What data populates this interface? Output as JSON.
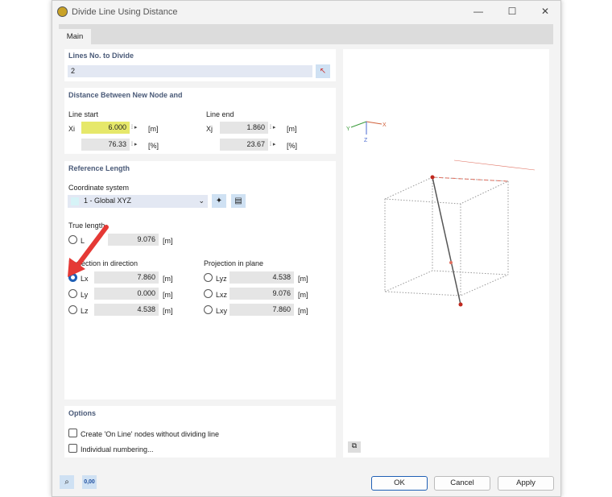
{
  "window": {
    "title": "Divide Line Using Distance",
    "minimize": "—",
    "maximize": "☐",
    "close": "✕"
  },
  "tabs": [
    {
      "label": "Main"
    }
  ],
  "lines": {
    "heading": "Lines No. to Divide",
    "value": "2"
  },
  "distance": {
    "heading": "Distance Between New Node and",
    "start": {
      "label": "Line start",
      "sym": "Xi",
      "value": "6.000",
      "unit": "[m]",
      "pct": "76.33",
      "pct_unit": "[%]"
    },
    "end": {
      "label": "Line end",
      "sym": "Xj",
      "value": "1.860",
      "unit": "[m]",
      "pct": "23.67",
      "pct_unit": "[%]"
    }
  },
  "reference": {
    "heading": "Reference Length",
    "cs_label": "Coordinate system",
    "cs_value": "1 - Global XYZ",
    "true_label": "True length",
    "true": {
      "sym": "L",
      "value": "9.076",
      "unit": "[m]"
    },
    "dir_label": "Projection in direction",
    "plane_label": "Projection in plane",
    "dir": [
      {
        "sym": "Lx",
        "value": "7.860",
        "unit": "[m]",
        "selected": true
      },
      {
        "sym": "Ly",
        "value": "0.000",
        "unit": "[m]"
      },
      {
        "sym": "Lz",
        "value": "4.538",
        "unit": "[m]"
      }
    ],
    "plane": [
      {
        "sym": "Lyz",
        "value": "4.538",
        "unit": "[m]"
      },
      {
        "sym": "Lxz",
        "value": "9.076",
        "unit": "[m]"
      },
      {
        "sym": "Lxy",
        "value": "7.860",
        "unit": "[m]"
      }
    ]
  },
  "options": {
    "heading": "Options",
    "items": [
      {
        "label": "Create 'On Line' nodes without dividing line",
        "checked": false
      },
      {
        "label": "Individual numbering...",
        "checked": false
      }
    ]
  },
  "axes": {
    "x": "X",
    "y": "Y",
    "z": "Z"
  },
  "footer": {
    "ok": "OK",
    "cancel": "Cancel",
    "apply": "Apply",
    "units_icon": "0,00"
  },
  "colors": {
    "accent": "#1f5fb5",
    "highlight": "#e6e86a",
    "arrow": "#e53935"
  }
}
